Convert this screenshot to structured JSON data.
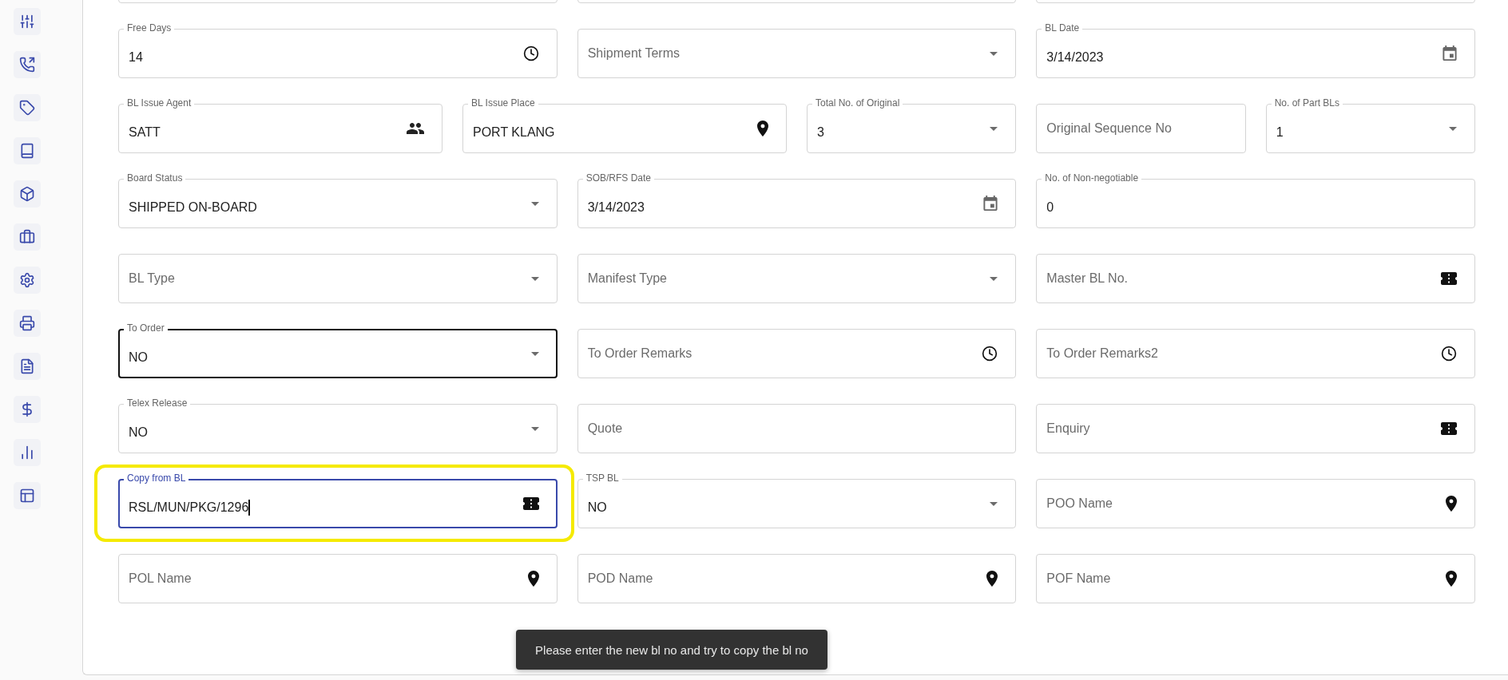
{
  "rows": [
    [
      {
        "kind": "cut-off"
      },
      {
        "kind": "cut-off"
      },
      {
        "kind": "cut-off"
      }
    ],
    [
      {
        "kind": "time",
        "label": "Free Days",
        "value": "14"
      },
      {
        "kind": "select",
        "placeholder": "Shipment Terms"
      },
      {
        "kind": "date",
        "label": "BL Date",
        "value": "3/14/2023"
      }
    ],
    [
      {
        "kind": "people",
        "label": "BL Issue Agent",
        "value": "SATT"
      },
      {
        "kind": "location",
        "label": "BL Issue Place",
        "value": "PORT KLANG"
      },
      {
        "kind": "select",
        "label": "Total No. of Original",
        "value": "3"
      },
      {
        "kind": "text",
        "placeholder": "Original Sequence No"
      },
      {
        "kind": "select",
        "label": "No. of Part BLs",
        "value": "1"
      }
    ],
    [
      {
        "kind": "select",
        "label": "Board Status",
        "value": "SHIPPED ON-BOARD"
      },
      {
        "kind": "date",
        "label": "SOB/RFS Date",
        "value": "3/14/2023"
      },
      {
        "kind": "text",
        "label": "No. of Non-negotiable",
        "value": "0"
      }
    ],
    [
      {
        "kind": "select",
        "placeholder": "BL Type"
      },
      {
        "kind": "select",
        "placeholder": "Manifest Type"
      },
      {
        "kind": "ticket",
        "placeholder": "Master BL No."
      }
    ],
    [
      {
        "kind": "select",
        "label": "To Order",
        "value": "NO",
        "hovered": true
      },
      {
        "kind": "time",
        "placeholder": "To Order Remarks"
      },
      {
        "kind": "time",
        "placeholder": "To Order Remarks2"
      }
    ],
    [
      {
        "kind": "select",
        "label": "Telex Release",
        "value": "NO"
      },
      {
        "kind": "text",
        "placeholder": "Quote"
      },
      {
        "kind": "ticket",
        "placeholder": "Enquiry"
      }
    ],
    [
      {
        "kind": "ticket",
        "label": "Copy from BL",
        "value": "RSL/MUN/PKG/1296",
        "focused": true,
        "highlighted": true
      },
      {
        "kind": "select",
        "label": "TSP BL",
        "value": "NO"
      },
      {
        "kind": "location",
        "placeholder": "POO Name"
      }
    ],
    [
      {
        "kind": "location",
        "placeholder": "POL Name"
      },
      {
        "kind": "location",
        "placeholder": "POD Name"
      },
      {
        "kind": "location",
        "placeholder": "POF Name"
      }
    ]
  ],
  "toast": {
    "message": "Please enter the new bl no and try to copy the bl no"
  }
}
